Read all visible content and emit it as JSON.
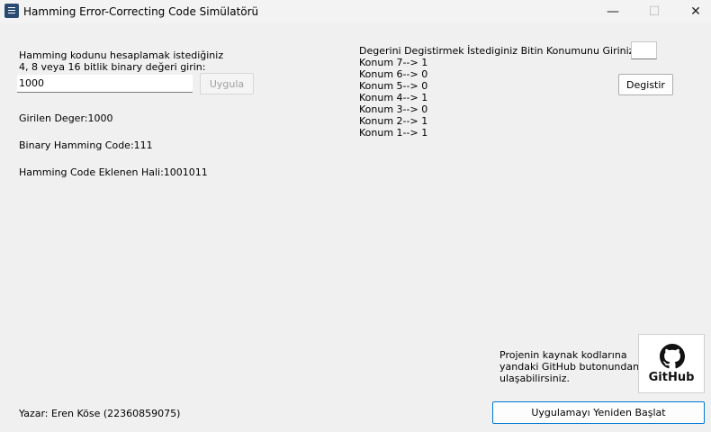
{
  "window": {
    "title": "Hamming Error-Correcting Code Simülatörü",
    "minimize_symbol": "—",
    "maximize_symbol": "☐",
    "close_symbol": "✕"
  },
  "input_section": {
    "prompt_line1": "Hamming kodunu hesaplamak istediğiniz",
    "prompt_line2": "4, 8 veya 16 bitlik binary değeri girin:",
    "binary_value": "1000",
    "apply_label": "Uygula"
  },
  "results": {
    "entered_value": "Girilen Deger:1000",
    "binary_hamming": "Binary Hamming Code:111",
    "hamming_added": "Hamming Code Eklenen Hali:1001011"
  },
  "bit_change": {
    "prompt": "Degerini Degistirmek İstediginiz Bitin Konumunu Giriniz:",
    "position_value": "",
    "change_label": "Degistir",
    "positions": [
      "Konum 7--> 1",
      "Konum 6--> 0",
      "Konum 5--> 0",
      "Konum 4--> 1",
      "Konum 3--> 0",
      "Konum 2--> 1",
      "Konum 1--> 1"
    ]
  },
  "footer": {
    "source_line1": "Projenin kaynak kodlarına",
    "source_line2": "yandaki GitHub butonundan -->",
    "source_line3": "ulaşabilirsiniz.",
    "github_label": "GitHub",
    "author": "Yazar: Eren Köse (22360859075)",
    "restart_label": "Uygulamayı Yeniden Başlat"
  }
}
